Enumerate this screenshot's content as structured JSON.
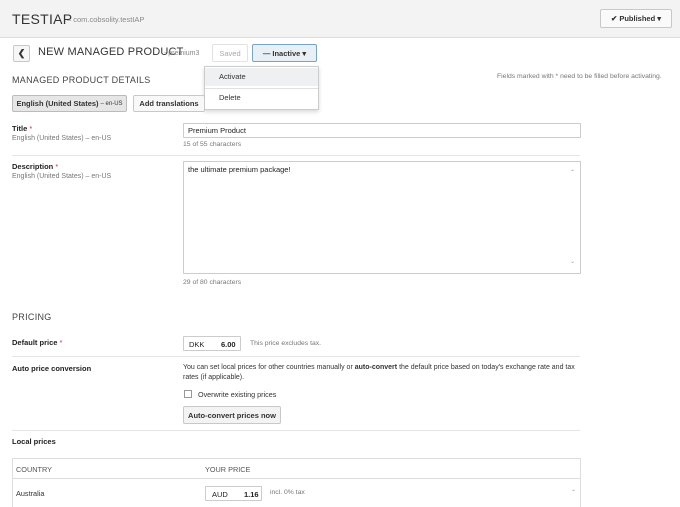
{
  "header": {
    "app_title": "TESTIAP",
    "app_package": "– com.cobsolity.testIAP",
    "published_label": "✔ Published ▾"
  },
  "product": {
    "back_glyph": "❮",
    "title": "NEW MANAGED PRODUCT",
    "subtitle": "- premium3",
    "saved_label": "Saved",
    "status_label": "— Inactive ▾"
  },
  "status_menu": {
    "items": [
      "Activate",
      "Delete"
    ]
  },
  "details": {
    "section_title": "MANAGED PRODUCT DETAILS",
    "required_note": "Fields marked with * need to be filled before activating.",
    "language_button": "English (United States)",
    "language_code": "– en-US",
    "add_translations": "Add translations",
    "title_label": "Title",
    "title_lang": "English (United States) – en-US",
    "title_value": "Premium Product",
    "title_count": "15 of 55 characters",
    "description_label": "Description",
    "description_lang": "English (United States) – en-US",
    "description_value": "the ultimate premium package!",
    "description_count": "29 of 80 characters",
    "required_mark": "*"
  },
  "pricing": {
    "section_title": "PRICING",
    "default_price_label": "Default price",
    "currency": "DKK",
    "amount": "6.00",
    "price_note": "This price excludes tax.",
    "auto_conversion_label": "Auto price conversion",
    "auto_text_1": "You can set local prices for other countries manually or ",
    "auto_text_bold": "auto-convert",
    "auto_text_2": " the default price based on today's exchange rate and tax rates (if applicable).",
    "overwrite_label": "Overwrite existing prices",
    "overwrite_checked": false,
    "autoconvert_button": "Auto-convert prices now",
    "local_prices_label": "Local prices"
  },
  "local_prices_table": {
    "headers": [
      "COUNTRY",
      "YOUR PRICE"
    ],
    "rows": [
      {
        "country": "Australia",
        "currency": "AUD",
        "amount": "1.16",
        "tax": "incl. 0% tax"
      }
    ]
  },
  "scroll_glyphs": {
    "up": "⌃",
    "down": "⌄"
  }
}
